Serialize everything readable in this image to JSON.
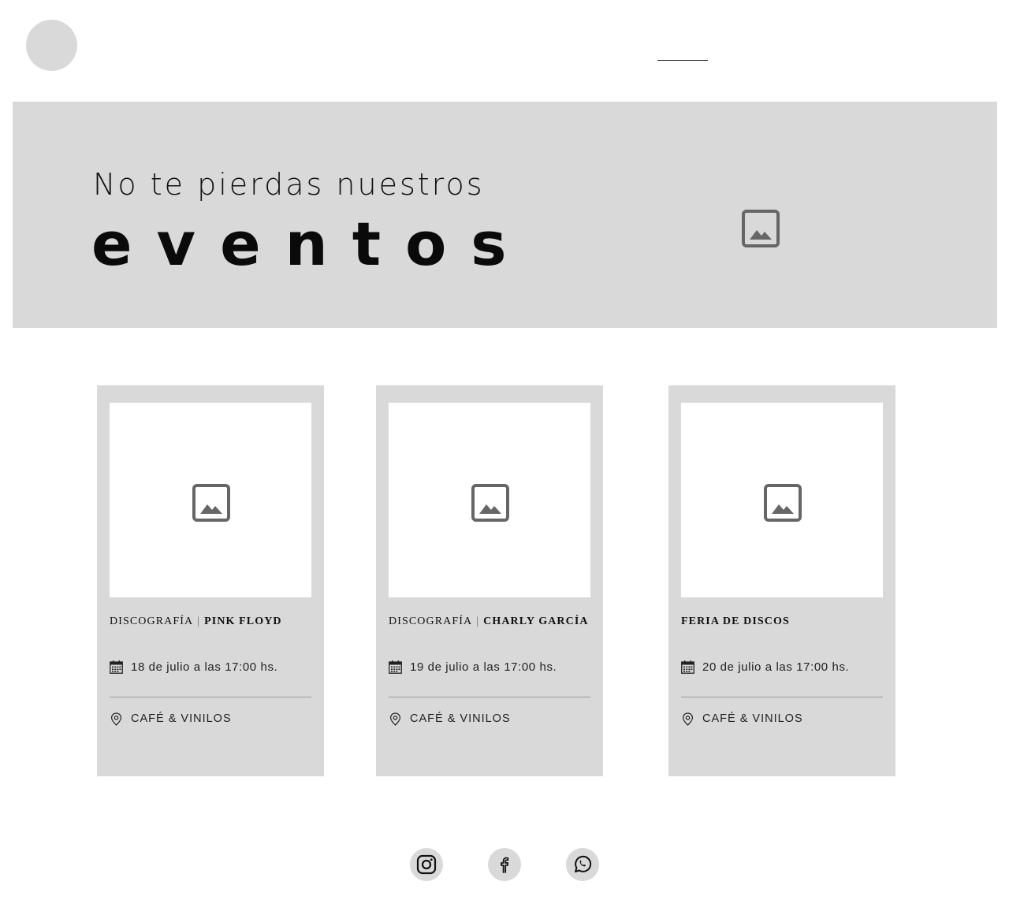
{
  "header": {
    "logo_icon": "circle-logo",
    "active_nav_indicator": "underline"
  },
  "hero": {
    "subtitle": "No te pierdas nuestros",
    "title": "eventos",
    "image_icon": "image-placeholder-icon"
  },
  "events": [
    {
      "category": "DISCOGRAFÍA",
      "separator": "|",
      "name": "PINK FLOYD",
      "date": "18 de julio a las 17:00 hs.",
      "location": "CAFÉ & VINILOS"
    },
    {
      "category": "DISCOGRAFÍA",
      "separator": "|",
      "name": "CHARLY GARCÍA",
      "date": "19 de julio a las 17:00 hs.",
      "location": "CAFÉ & VINILOS"
    },
    {
      "category": "",
      "separator": "",
      "name": "FERIA DE DISCOS",
      "date": "20 de julio a las 17:00 hs.",
      "location": "CAFÉ & VINILOS"
    }
  ],
  "footer": {
    "social": [
      {
        "icon": "instagram-icon"
      },
      {
        "icon": "facebook-icon"
      },
      {
        "icon": "whatsapp-icon"
      }
    ]
  },
  "colors": {
    "placeholder_gray": "#d9d9d9",
    "icon_gray": "#666666",
    "text": "#111111"
  }
}
